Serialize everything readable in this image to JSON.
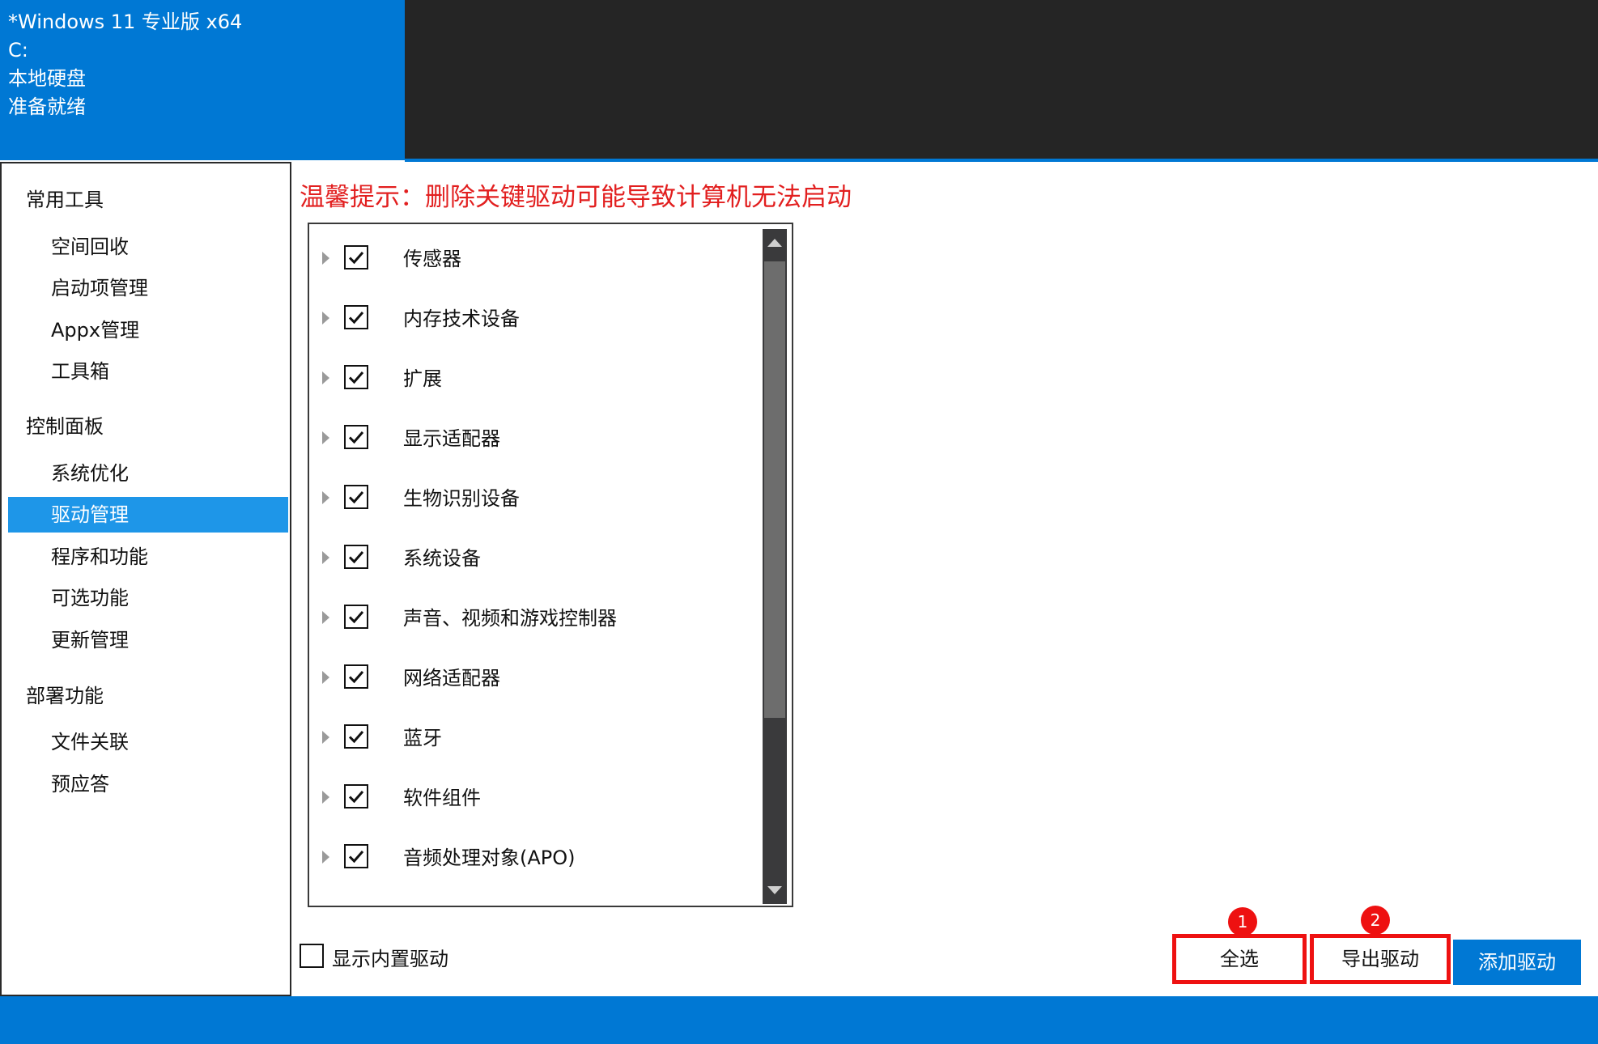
{
  "header": {
    "os_name": "*Windows 11 专业版 x64",
    "drive": "C:",
    "disk_label": "本地硬盘",
    "status": "准备就绪",
    "background_color": "#0078d4"
  },
  "sidebar": {
    "groups": [
      {
        "label": "常用工具",
        "items": [
          "空间回收",
          "启动项管理",
          "Appx管理",
          "工具箱"
        ]
      },
      {
        "label": "控制面板",
        "items": [
          "系统优化",
          "驱动管理",
          "程序和功能",
          "可选功能",
          "更新管理"
        ]
      },
      {
        "label": "部署功能",
        "items": [
          "文件关联",
          "预应答"
        ]
      }
    ],
    "active_item": "驱动管理",
    "active_color": "#1e96e8"
  },
  "warning": "温馨提示：删除关键驱动可能导致计算机无法启动",
  "driver_tree": {
    "items": [
      {
        "label": "传感器",
        "checked": true
      },
      {
        "label": "内存技术设备",
        "checked": true
      },
      {
        "label": "扩展",
        "checked": true
      },
      {
        "label": "显示适配器",
        "checked": true
      },
      {
        "label": "生物识别设备",
        "checked": true
      },
      {
        "label": "系统设备",
        "checked": true
      },
      {
        "label": "声音、视频和游戏控制器",
        "checked": true
      },
      {
        "label": "网络适配器",
        "checked": true
      },
      {
        "label": "蓝牙",
        "checked": true
      },
      {
        "label": "软件组件",
        "checked": true
      },
      {
        "label": "音频处理对象(APO)",
        "checked": true
      }
    ]
  },
  "show_builtin": {
    "label": "显示内置驱动",
    "checked": false
  },
  "buttons": {
    "select_all": "全选",
    "export": "导出驱动",
    "add": "添加驱动"
  },
  "badges": {
    "one": "1",
    "two": "2"
  },
  "colors": {
    "accent": "#0078d4",
    "warning": "#e21f1f",
    "highlight": "#ee1111"
  }
}
